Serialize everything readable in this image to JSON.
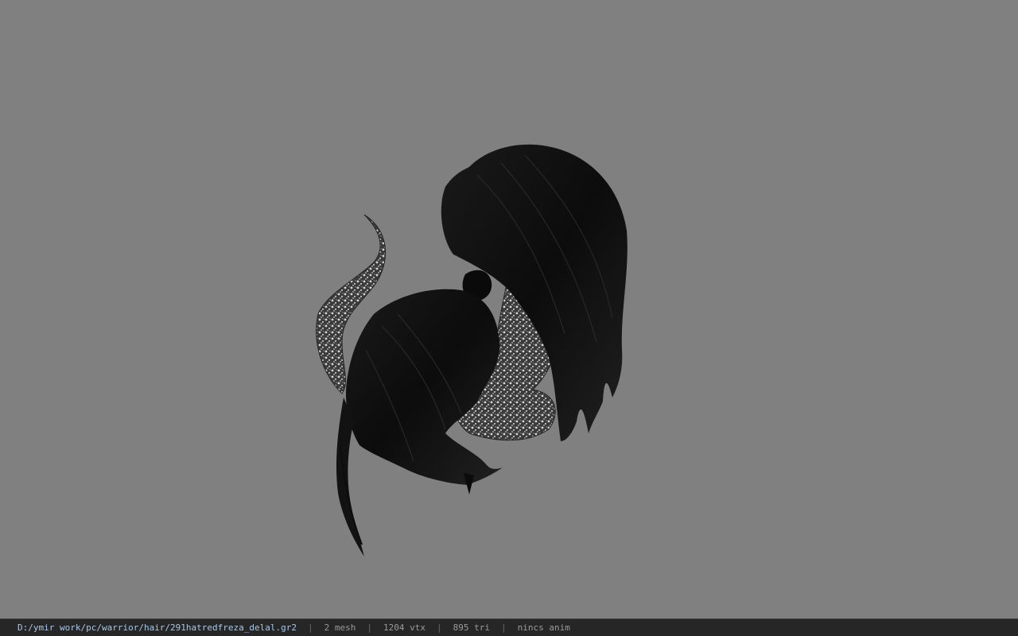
{
  "viewport": {
    "background_color": "#808080",
    "model_description_icon": "hair-model"
  },
  "status_bar": {
    "file_path": "D:/ymir work/pc/warrior/hair/291hatredfreza_delal.gr2",
    "separator": "|",
    "mesh_count": "2 mesh",
    "vertex_count": "1204 vtx",
    "triangle_count": "895 tri",
    "anim_status": "nincs anim"
  }
}
